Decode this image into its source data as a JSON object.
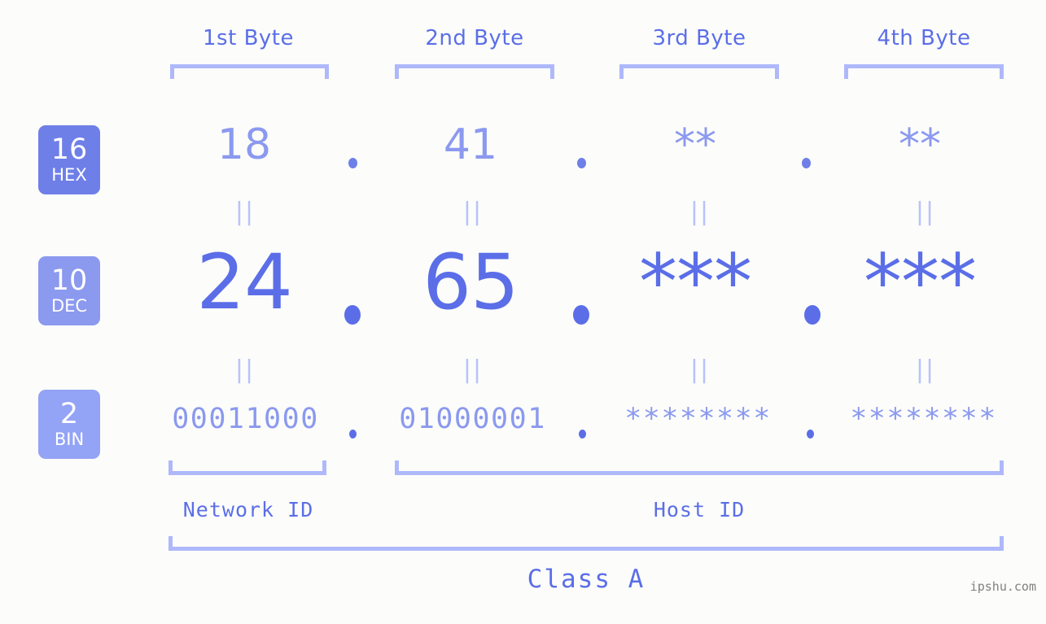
{
  "background_color": "#fcfdfa",
  "accent_color": "#5b6ee8",
  "accent_light": "#8b99ef",
  "accent_pale": "#aeb8fb",
  "headers": {
    "byte1": "1st Byte",
    "byte2": "2nd Byte",
    "byte3": "3rd Byte",
    "byte4": "4th Byte"
  },
  "radix_badges": [
    {
      "num": "16",
      "sub": "HEX",
      "color": "#6f7fe8"
    },
    {
      "num": "10",
      "sub": "DEC",
      "color": "#8b99ef"
    },
    {
      "num": "2",
      "sub": "BIN",
      "color": "#93a3f5"
    }
  ],
  "rows": {
    "hex": {
      "label": "HEX",
      "byte1": "18",
      "byte2": "41",
      "byte3": "**",
      "byte4": "**",
      "separator": "."
    },
    "dec": {
      "label": "DEC",
      "byte1": "24",
      "byte2": "65",
      "byte3": "***",
      "byte4": "***",
      "separator": "."
    },
    "bin": {
      "label": "BIN",
      "byte1": "00011000",
      "byte2": "01000001",
      "byte3": "********",
      "byte4": "********",
      "separator": "."
    }
  },
  "equals_marker": "||",
  "id_labels": {
    "network": "Network ID",
    "host": "Host ID"
  },
  "class_label": "Class A",
  "watermark": "ipshu.com"
}
